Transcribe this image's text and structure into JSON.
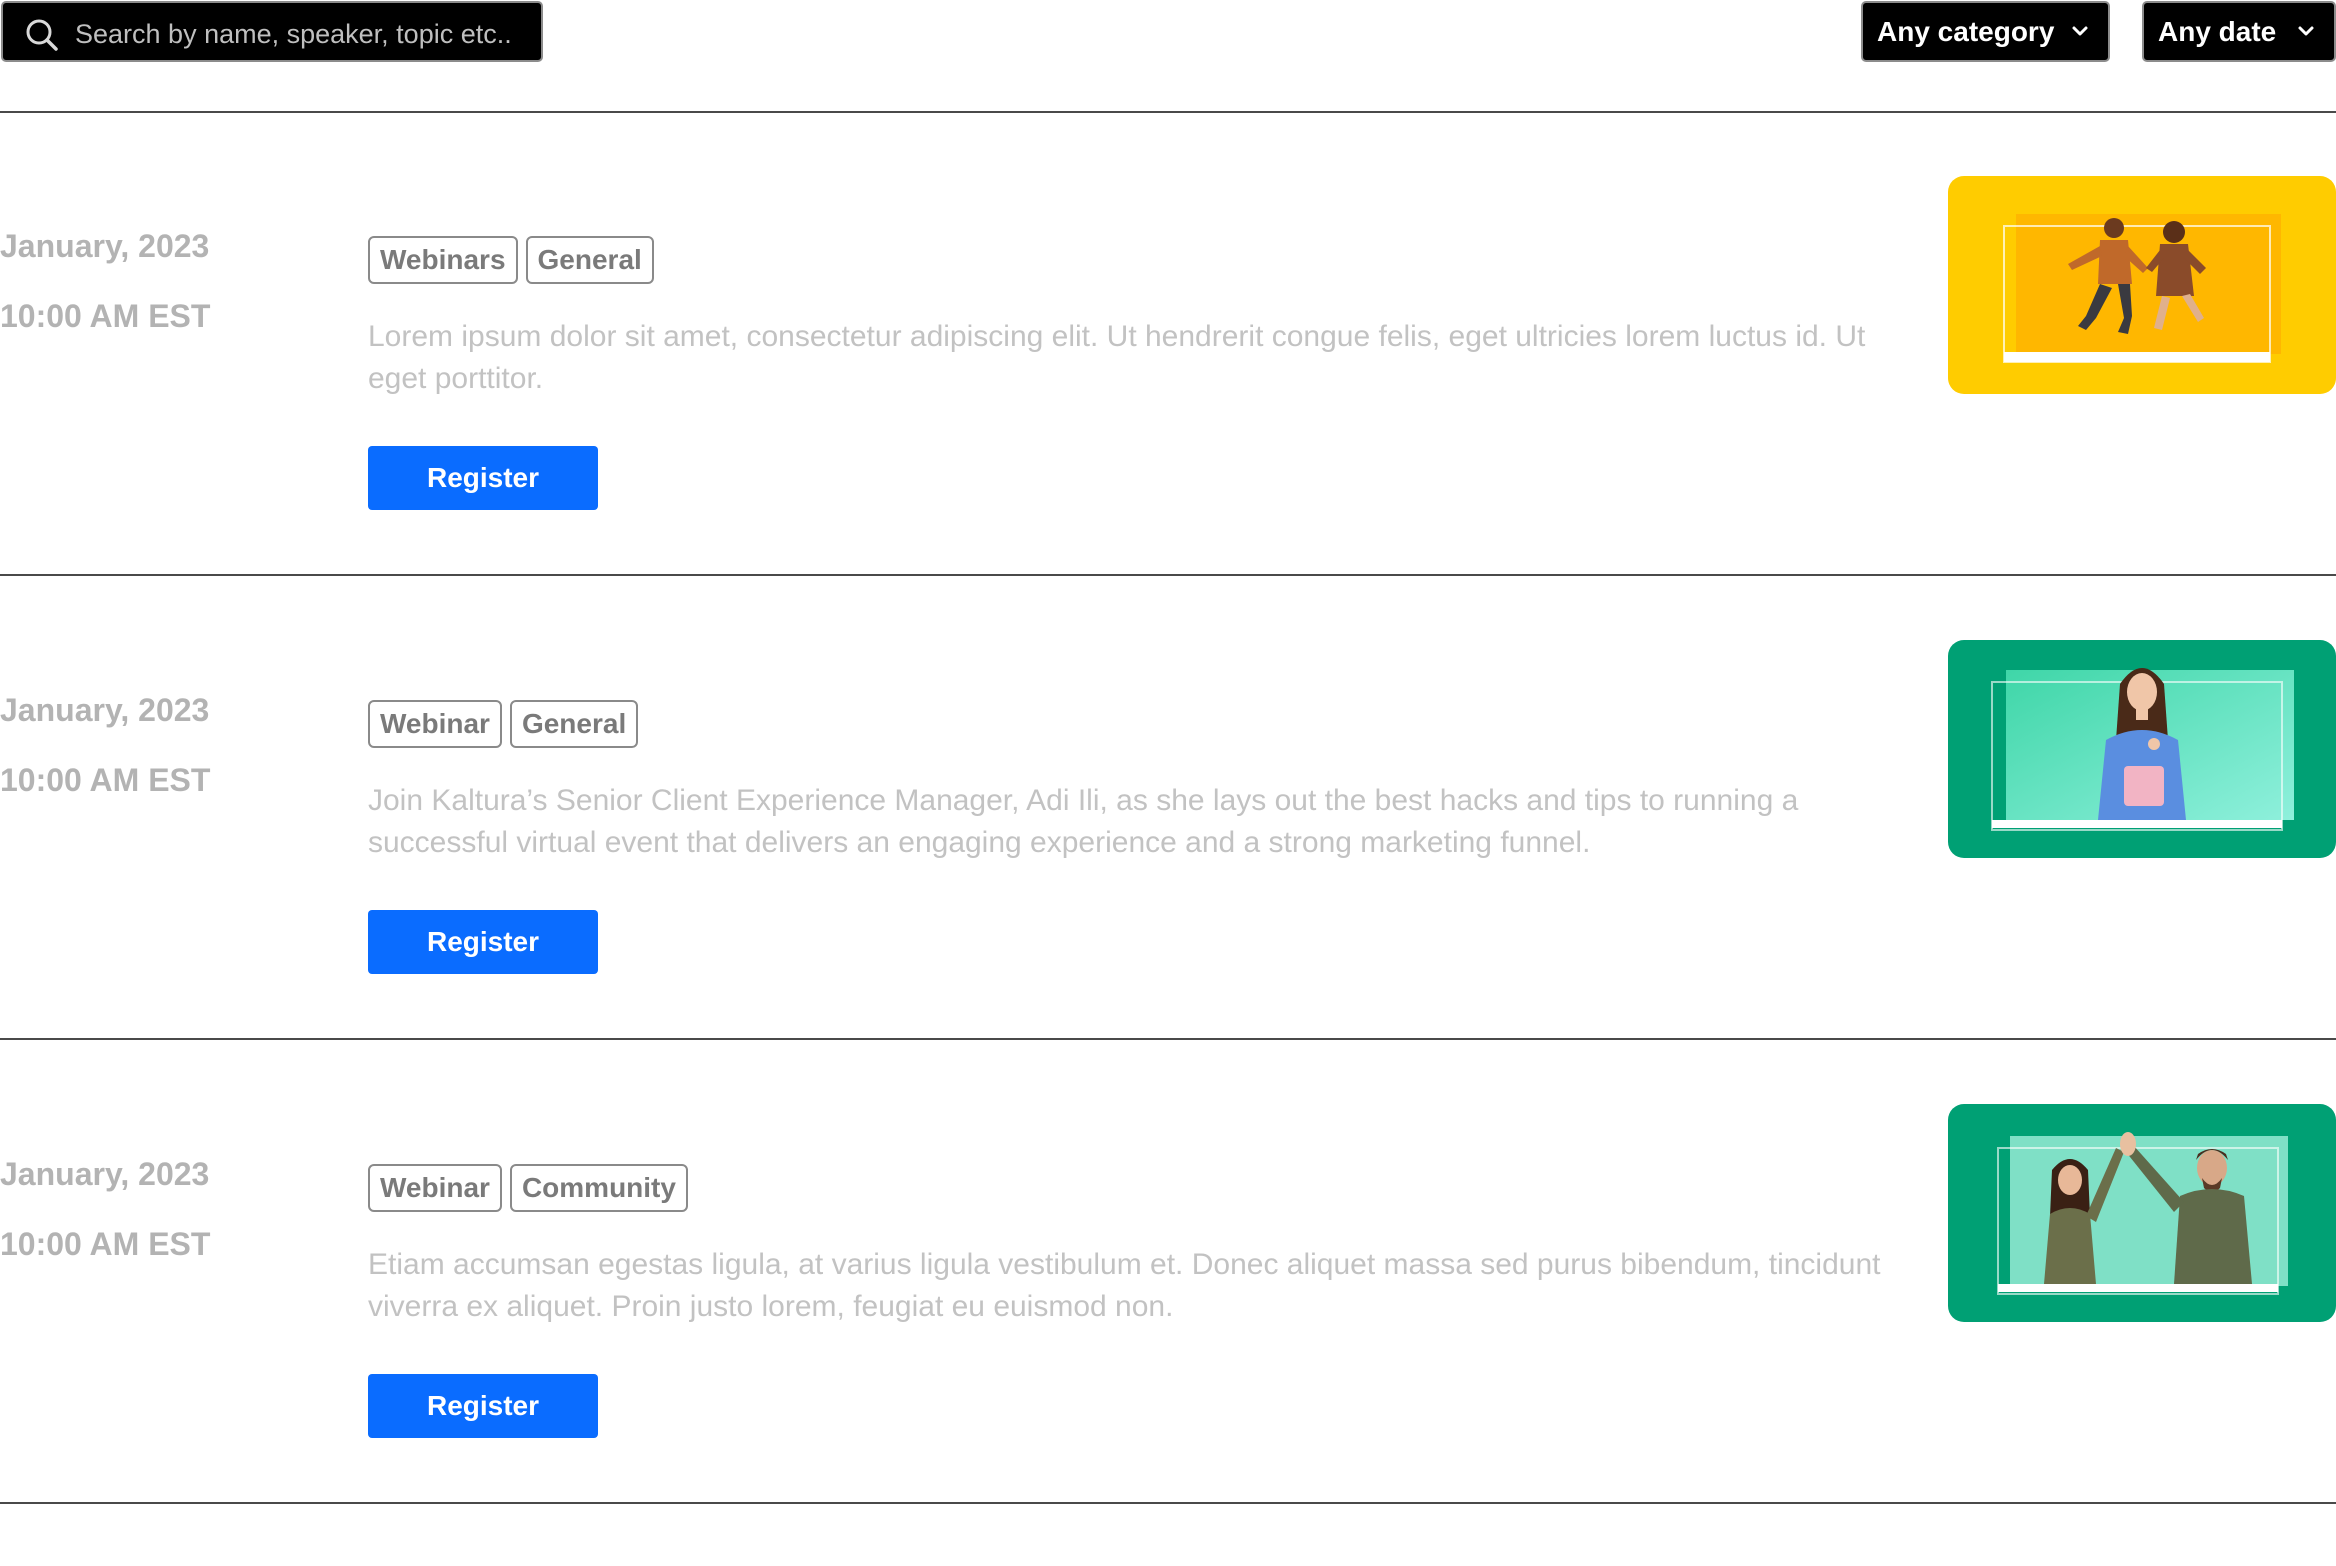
{
  "search": {
    "placeholder": "Search by name, speaker, topic etc.."
  },
  "filters": {
    "category": "Any category",
    "date": "Any date"
  },
  "colors": {
    "accent": "#0a6cff",
    "thumb_yellow": "#ffcc00",
    "thumb_green": "#00a074"
  },
  "events": [
    {
      "date": "January, 2023",
      "time": "10:00 AM EST",
      "tags": [
        "Webinars",
        "General"
      ],
      "description": "Lorem ipsum dolor sit amet, consectetur adipiscing elit. Ut hendrerit congue felis, eget ultricies lorem luctus id. Ut eget porttitor.",
      "button": "Register",
      "thumbnail": "jumping-couple-image"
    },
    {
      "date": "January, 2023",
      "time": "10:00 AM EST",
      "tags": [
        "Webinar",
        "General"
      ],
      "description": "Join Kaltura’s Senior Client Experience Manager, Adi Ili, as she lays out the best hacks and tips to running a successful virtual event that delivers an engaging experience and a strong marketing funnel.",
      "button": "Register",
      "thumbnail": "woman-with-tablet-image"
    },
    {
      "date": "January, 2023",
      "time": "10:00 AM EST",
      "tags": [
        "Webinar",
        "Community"
      ],
      "description": "Etiam accumsan egestas ligula, at varius ligula vestibulum et. Donec aliquet massa sed purus bibendum, tincidunt viverra ex aliquet. Proin justo lorem, feugiat eu euismod non.",
      "button": "Register",
      "thumbnail": "high-five-image"
    }
  ]
}
